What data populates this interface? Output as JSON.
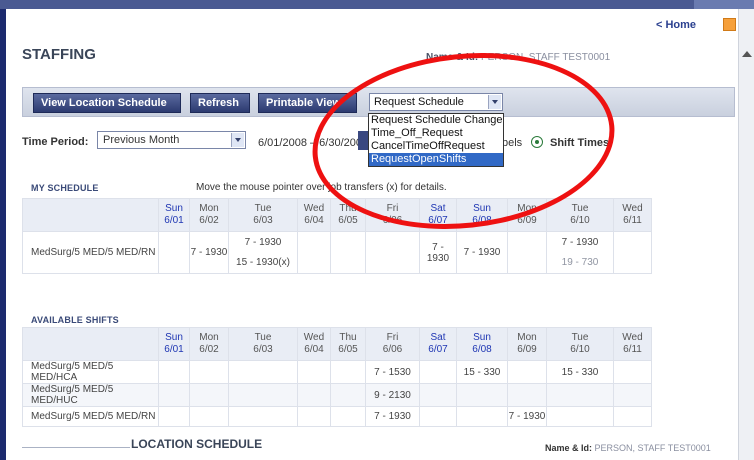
{
  "header": {
    "home_link": "< Home",
    "title": "STAFFING",
    "name_id_label": "Name & Id:",
    "name_id_value": "PERSON, STAFF   TEST0001"
  },
  "toolbar": {
    "view_location": "View Location Schedule ⇒",
    "refresh": "Refresh",
    "printable_view": "Printable View ⇒",
    "request_select_value": "Request Schedule Change"
  },
  "dropdown": {
    "options": [
      "Request Schedule Change",
      "Time_Off_Request",
      "CancelTimeOffRequest",
      "RequestOpenShifts"
    ],
    "selected_index": 3
  },
  "filters": {
    "time_period_label": "Time Period:",
    "time_period_value": "Previous Month",
    "date_range": "6/01/2008 – 6/30/2008",
    "labels_text": "bels",
    "shift_times": "Shift Times"
  },
  "my_schedule": {
    "heading": "MY SCHEDULE",
    "hint": "Move the mouse pointer over job transfers (x) for details.",
    "days": [
      {
        "d": "Sun",
        "date": "6/01",
        "weekend": true
      },
      {
        "d": "Mon",
        "date": "6/02",
        "weekend": false
      },
      {
        "d": "Tue",
        "date": "6/03",
        "weekend": false
      },
      {
        "d": "Wed",
        "date": "6/04",
        "weekend": false
      },
      {
        "d": "Thu",
        "date": "6/05",
        "weekend": false
      },
      {
        "d": "Fri",
        "date": "6/06",
        "weekend": false
      },
      {
        "d": "Sat",
        "date": "6/07",
        "weekend": true
      },
      {
        "d": "Sun",
        "date": "6/08",
        "weekend": true
      },
      {
        "d": "Mon",
        "date": "6/09",
        "weekend": false
      },
      {
        "d": "Tue",
        "date": "6/10",
        "weekend": false
      },
      {
        "d": "Wed",
        "date": "6/11",
        "weekend": false
      }
    ],
    "rows": [
      {
        "location": "MedSurg/5 MED/5 MED/RN",
        "cells": [
          "",
          "7 - 1930",
          "7 - 1930|15 - 1930(x)",
          "",
          "",
          "",
          "7 - 1930",
          "7 - 1930",
          "",
          "7 - 1930|19 - 730",
          ""
        ]
      }
    ]
  },
  "available_shifts": {
    "heading": "AVAILABLE SHIFTS",
    "rows": [
      {
        "location": "MedSurg/5 MED/5 MED/HCA",
        "cells": [
          "",
          "",
          "",
          "",
          "",
          "7 - 1530",
          "",
          "15 - 330",
          "",
          "15 - 330",
          ""
        ]
      },
      {
        "location": "MedSurg/5 MED/5 MED/HUC",
        "cells": [
          "",
          "",
          "",
          "",
          "",
          "9 - 2130",
          "",
          "",
          "",
          "",
          ""
        ]
      },
      {
        "location": "MedSurg/5 MED/5 MED/RN",
        "cells": [
          "",
          "",
          "",
          "",
          "",
          "7 - 1930",
          "",
          "",
          "7 - 1930",
          "",
          ""
        ]
      }
    ]
  },
  "footer": {
    "location_schedule": "LOCATION SCHEDULE",
    "name_id_label": "Name & Id:",
    "name_id_value": "PERSON, STAFF   TEST0001"
  },
  "colors": {
    "accent": "#2c3a70",
    "weekend_text": "#1f36b3",
    "annotation": "#ee1111",
    "selected_option": "#3169c6"
  }
}
